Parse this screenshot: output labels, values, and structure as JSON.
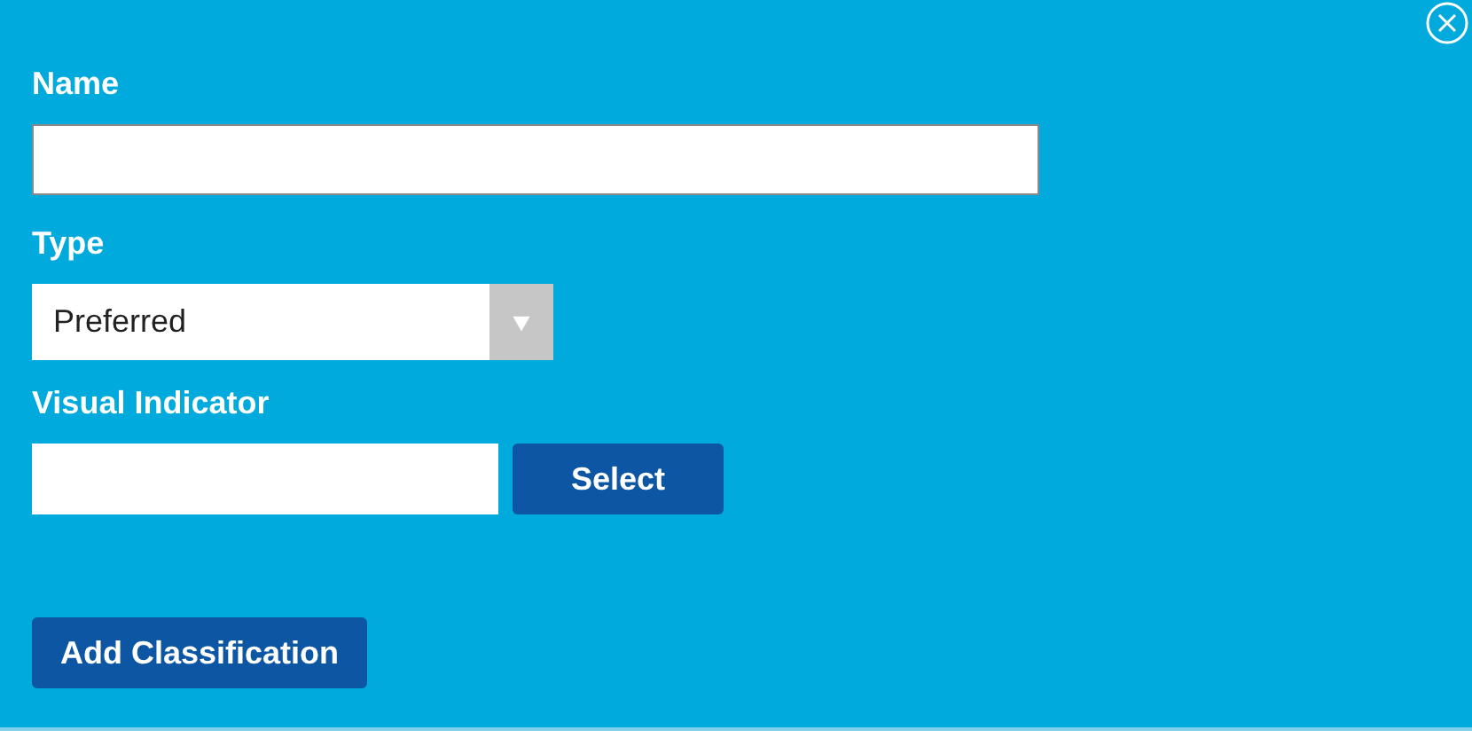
{
  "fields": [
    {
      "kind": "text",
      "label": "Name"
    },
    {
      "kind": "select",
      "label": "Type",
      "value": "Preferred"
    },
    {
      "kind": "picker",
      "label": "Visual Indicator",
      "button": "Select"
    }
  ],
  "submit": "Add Classification"
}
